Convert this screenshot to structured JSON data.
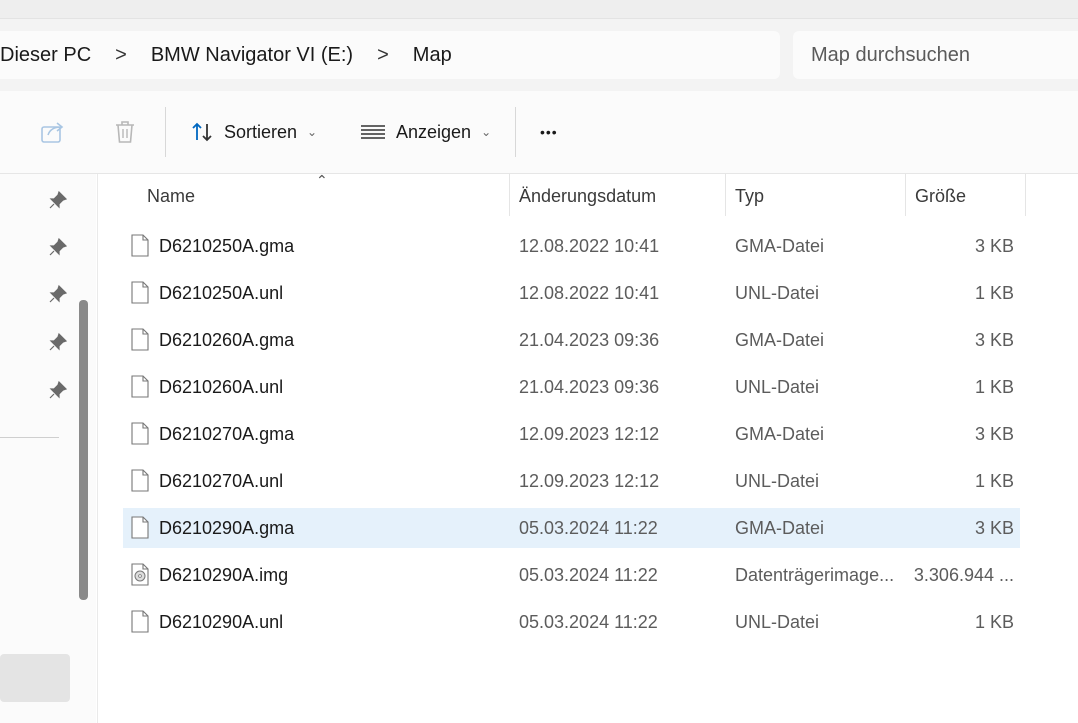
{
  "address": {
    "crumbs": [
      "Dieser PC",
      "BMW Navigator VI (E:)",
      "Map"
    ],
    "separator": ">"
  },
  "search": {
    "placeholder": "Map durchsuchen"
  },
  "toolbar": {
    "share_icon": "share-icon",
    "delete_icon": "trash-icon",
    "sort_label": "Sortieren",
    "view_label": "Anzeigen",
    "more_label": "•••"
  },
  "sidebar": {
    "pins": 5
  },
  "columns": {
    "name": "Name",
    "date": "Änderungsdatum",
    "type": "Typ",
    "size": "Größe"
  },
  "files": [
    {
      "name": "D6210250A.gma",
      "date": "12.08.2022 10:41",
      "type": "GMA-Datei",
      "size": "3 KB",
      "icon": "file-icon"
    },
    {
      "name": "D6210250A.unl",
      "date": "12.08.2022 10:41",
      "type": "UNL-Datei",
      "size": "1 KB",
      "icon": "file-icon"
    },
    {
      "name": "D6210260A.gma",
      "date": "21.04.2023 09:36",
      "type": "GMA-Datei",
      "size": "3 KB",
      "icon": "file-icon"
    },
    {
      "name": "D6210260A.unl",
      "date": "21.04.2023 09:36",
      "type": "UNL-Datei",
      "size": "1 KB",
      "icon": "file-icon"
    },
    {
      "name": "D6210270A.gma",
      "date": "12.09.2023 12:12",
      "type": "GMA-Datei",
      "size": "3 KB",
      "icon": "file-icon"
    },
    {
      "name": "D6210270A.unl",
      "date": "12.09.2023 12:12",
      "type": "UNL-Datei",
      "size": "1 KB",
      "icon": "file-icon"
    },
    {
      "name": "D6210290A.gma",
      "date": "05.03.2024 11:22",
      "type": "GMA-Datei",
      "size": "3 KB",
      "icon": "file-icon",
      "selected": true
    },
    {
      "name": "D6210290A.img",
      "date": "05.03.2024 11:22",
      "type": "Datenträgerimage...",
      "size": "3.306.944 ...",
      "icon": "disk-image-icon"
    },
    {
      "name": "D6210290A.unl",
      "date": "05.03.2024 11:22",
      "type": "UNL-Datei",
      "size": "1 KB",
      "icon": "file-icon"
    }
  ],
  "colors": {
    "selection": "#e5f1fb",
    "accent": "#0067c0"
  }
}
